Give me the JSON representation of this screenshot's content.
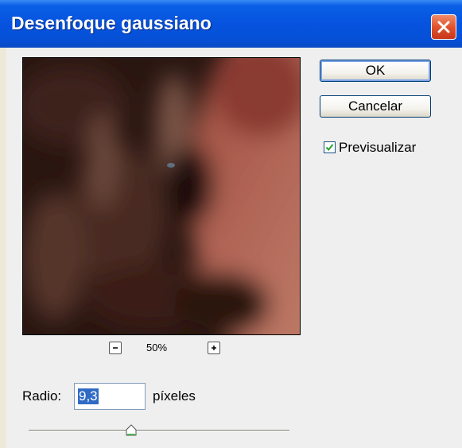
{
  "window": {
    "title": "Desenfoque gaussiano"
  },
  "buttons": {
    "ok": "OK",
    "cancel": "Cancelar"
  },
  "preview_toggle": {
    "label": "Previsualizar",
    "checked": true
  },
  "preview": {
    "zoom": "50%"
  },
  "radius": {
    "label": "Radio:",
    "value": "9,3",
    "unit": "píxeles"
  },
  "slider": {
    "value": 9.3
  },
  "colors": {
    "titlebar": "#0553dc",
    "close_button": "#e0522c",
    "selection": "#316ac5",
    "checkmark": "#21a121"
  }
}
